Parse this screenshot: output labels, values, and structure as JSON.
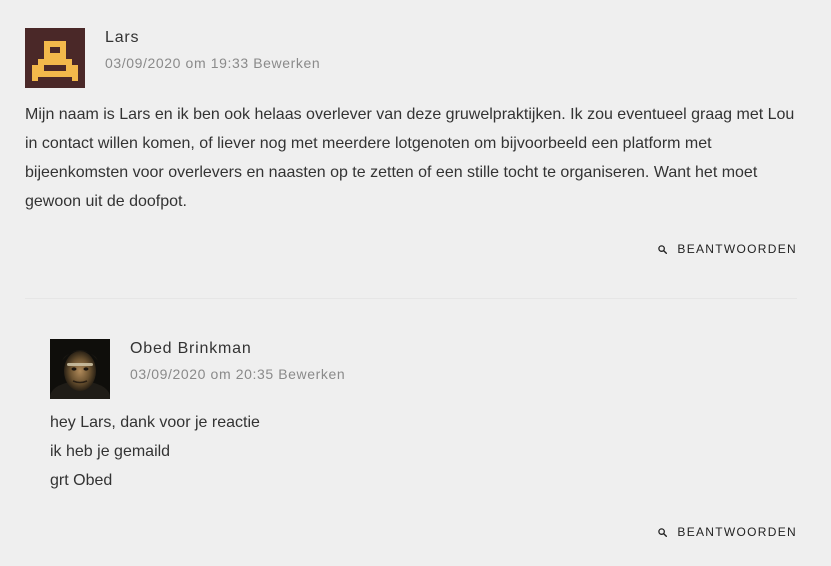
{
  "comments": [
    {
      "author": "Lars",
      "date": "03/09/2020 om 19:33",
      "edit_label": "Bewerken",
      "avatar_icon": "pixel-identicon",
      "avatar_colors": {
        "background": "#4a2828",
        "foreground": "#f2b84b"
      },
      "paragraphs": [
        "Mijn naam is Lars en ik ben ook helaas overlever van deze gruwelpraktijken. Ik zou eventueel graag met Lou in contact willen komen, of liever nog met meerdere lotgenoten om bijvoorbeeld een platform met bijeenkomsten voor overlevers en naasten op te zetten of een stille tocht te organiseren. Want het moet gewoon uit de doofpot."
      ],
      "reply_label": "BEANTWOORDEN"
    },
    {
      "author": "Obed Brinkman",
      "date": "03/09/2020 om 20:35",
      "edit_label": "Bewerken",
      "avatar_icon": "user-photo",
      "paragraphs": [
        "hey Lars, dank voor je reactie",
        "ik heb je gemaild",
        "grt Obed"
      ],
      "reply_label": "BEANTWOORDEN"
    }
  ],
  "colors": {
    "page_background": "#efefef",
    "text": "#333333",
    "meta_text": "#8a8a8a",
    "divider": "#e6e6e6"
  }
}
